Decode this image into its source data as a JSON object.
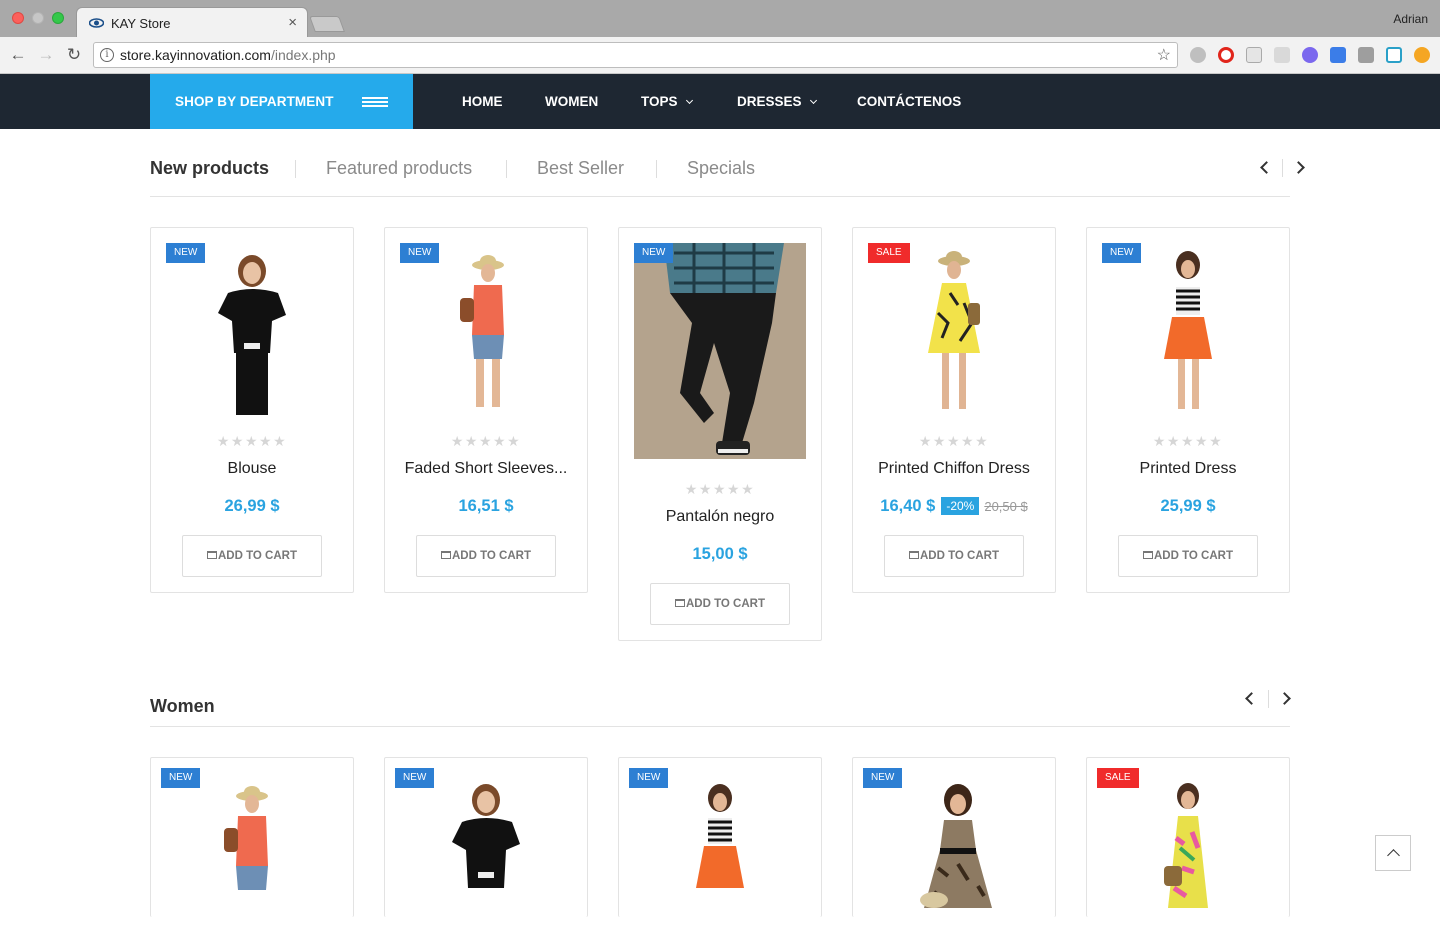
{
  "browser": {
    "tab_title": "KAY Store",
    "profile_name": "Adrian",
    "url_host": "store.kayinnovation.com",
    "url_path": "/index.php"
  },
  "nav": {
    "shop_by_department": "SHOP BY DEPARTMENT",
    "items": [
      "HOME",
      "WOMEN",
      "TOPS",
      "DRESSES",
      "CONTÁCTENOS"
    ]
  },
  "sections": {
    "tabs": [
      "New products",
      "Featured products",
      "Best Seller",
      "Specials"
    ],
    "women_title": "Women"
  },
  "products": [
    {
      "badge": "NEW",
      "name": "Blouse",
      "price": "26,99 $",
      "discount": "",
      "old_price": "",
      "rating": 0,
      "cart": "ADD TO CART"
    },
    {
      "badge": "NEW",
      "name": "Faded Short Sleeves...",
      "price": "16,51 $",
      "discount": "",
      "old_price": "",
      "rating": 0,
      "cart": "ADD TO CART"
    },
    {
      "badge": "NEW",
      "name": "Pantalón negro",
      "price": "15,00 $",
      "discount": "",
      "old_price": "",
      "rating": 0,
      "cart": "ADD TO CART"
    },
    {
      "badge": "SALE",
      "name": "Printed Chiffon Dress",
      "price": "16,40 $",
      "discount": "-20%",
      "old_price": "20,50 $",
      "rating": 0,
      "cart": "ADD TO CART"
    },
    {
      "badge": "NEW",
      "name": "Printed Dress",
      "price": "25,99 $",
      "discount": "",
      "old_price": "",
      "rating": 0,
      "cart": "ADD TO CART"
    }
  ],
  "women_products": [
    {
      "badge": "NEW"
    },
    {
      "badge": "NEW"
    },
    {
      "badge": "NEW"
    },
    {
      "badge": "NEW"
    },
    {
      "badge": "SALE"
    }
  ],
  "colors": {
    "accent": "#25aaeb",
    "nav_bg": "#1e2732",
    "badge_new": "#2d7fd3",
    "badge_sale": "#f02b2b"
  }
}
